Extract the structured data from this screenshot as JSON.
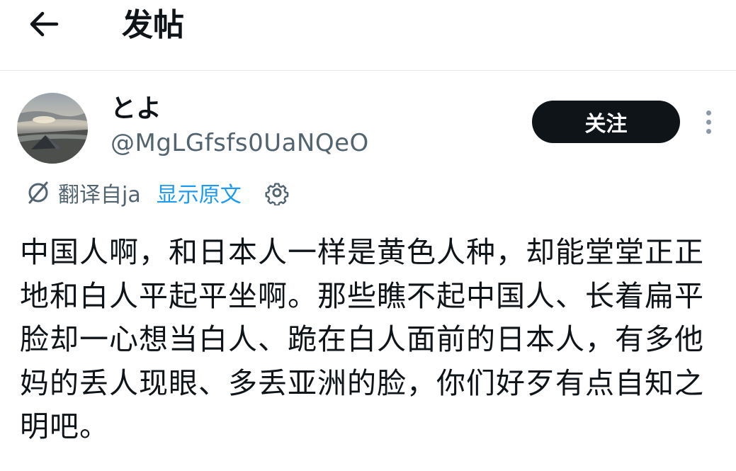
{
  "header": {
    "title": "发帖",
    "back_icon": "arrow-left-icon"
  },
  "author": {
    "display_name": "とよ",
    "handle": "@MgLGfsfs0UaNQeO",
    "avatar_icon": "tent-landscape-avatar"
  },
  "actions": {
    "follow_label": "关注",
    "more_icon": "more-vertical-icon"
  },
  "translation": {
    "icon": "translate-icon",
    "translated_from": "翻译自ja",
    "show_original": "显示原文",
    "settings_icon": "gear-icon"
  },
  "post": {
    "text": "中国人啊，和日本人一样是黄色人种，却能堂堂正正地和白人平起平坐啊。那些瞧不起中国人、长着扁平脸却一心想当白人、跪在白人面前的日本人，有多他妈的丢人现眼、多丢亚洲的脸，你们好歹有点自知之明吧。"
  },
  "colors": {
    "text_primary": "#0f1419",
    "text_secondary": "#536471",
    "link": "#1d9bf0",
    "button_bg": "#0f1419"
  }
}
